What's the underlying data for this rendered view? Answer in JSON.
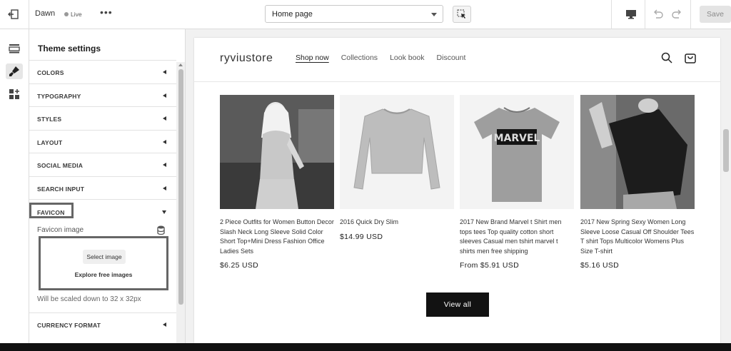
{
  "topbar": {
    "theme_name": "Dawn",
    "live_label": "Live",
    "more_label": "•••",
    "page_select": "Home page",
    "save_label": "Save"
  },
  "rail": {
    "items": [
      "sections-icon",
      "theme-settings-icon",
      "apps-icon"
    ]
  },
  "panel": {
    "title": "Theme settings",
    "sections": [
      {
        "label": "COLORS"
      },
      {
        "label": "TYPOGRAPHY"
      },
      {
        "label": "STYLES"
      },
      {
        "label": "LAYOUT"
      },
      {
        "label": "SOCIAL MEDIA"
      },
      {
        "label": "SEARCH INPUT"
      },
      {
        "label": "FAVICON"
      },
      {
        "label": "CURRENCY FORMAT"
      }
    ],
    "favicon": {
      "field_label": "Favicon image",
      "select_label": "Select image",
      "explore_label": "Explore free images",
      "info": "Will be scaled down to 32 x 32px"
    }
  },
  "store": {
    "name": "ryviustore",
    "nav": [
      "Shop now",
      "Collections",
      "Look book",
      "Discount"
    ],
    "products": [
      {
        "title": "2 Piece Outfits for Women Button Decor Slash Neck Long Sleeve Solid Color Short Top+Mini Dress Fashion Office Ladies Sets",
        "price": "$6.25 USD"
      },
      {
        "title": "2016 Quick Dry Slim",
        "price": "$14.99 USD"
      },
      {
        "title": "2017 New Brand Marvel t Shirt men tops tees Top quality cotton short sleeves Casual men tshirt marvel t shirts men free shipping",
        "price": "From $5.91 USD"
      },
      {
        "title": "2017 New Spring Sexy Women Long Sleeve Loose Casual Off Shoulder Tees T shirt Tops Multicolor Womens Plus Size T-shirt",
        "price": "$5.16 USD"
      }
    ],
    "tshirt_print": "MARVEL",
    "view_all_label": "View all"
  }
}
